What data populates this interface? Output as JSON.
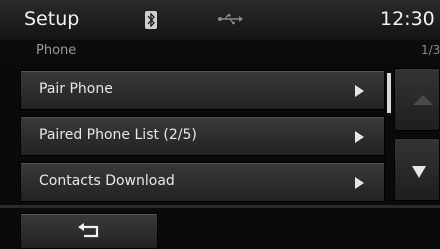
{
  "header": {
    "title": "Setup",
    "clock": "12:30",
    "bluetooth_icon": "bluetooth-icon",
    "usb_icon": "usb-icon"
  },
  "subheader": {
    "title": "Phone",
    "page_indicator": "1/3"
  },
  "menu": {
    "items": [
      {
        "label": "Pair Phone",
        "icon": "chevron-right-icon"
      },
      {
        "label": "Paired Phone List (2/5)",
        "icon": "chevron-right-icon"
      },
      {
        "label": "Contacts Download",
        "icon": "chevron-right-icon"
      }
    ]
  },
  "controls": {
    "back_icon": "back-arrow-icon",
    "scroll_up_icon": "arrow-up-icon",
    "scroll_down_icon": "arrow-down-icon"
  },
  "colors": {
    "background": "#0a0a0a",
    "button": "#2e2e2e",
    "text": "#e8e8e8"
  }
}
